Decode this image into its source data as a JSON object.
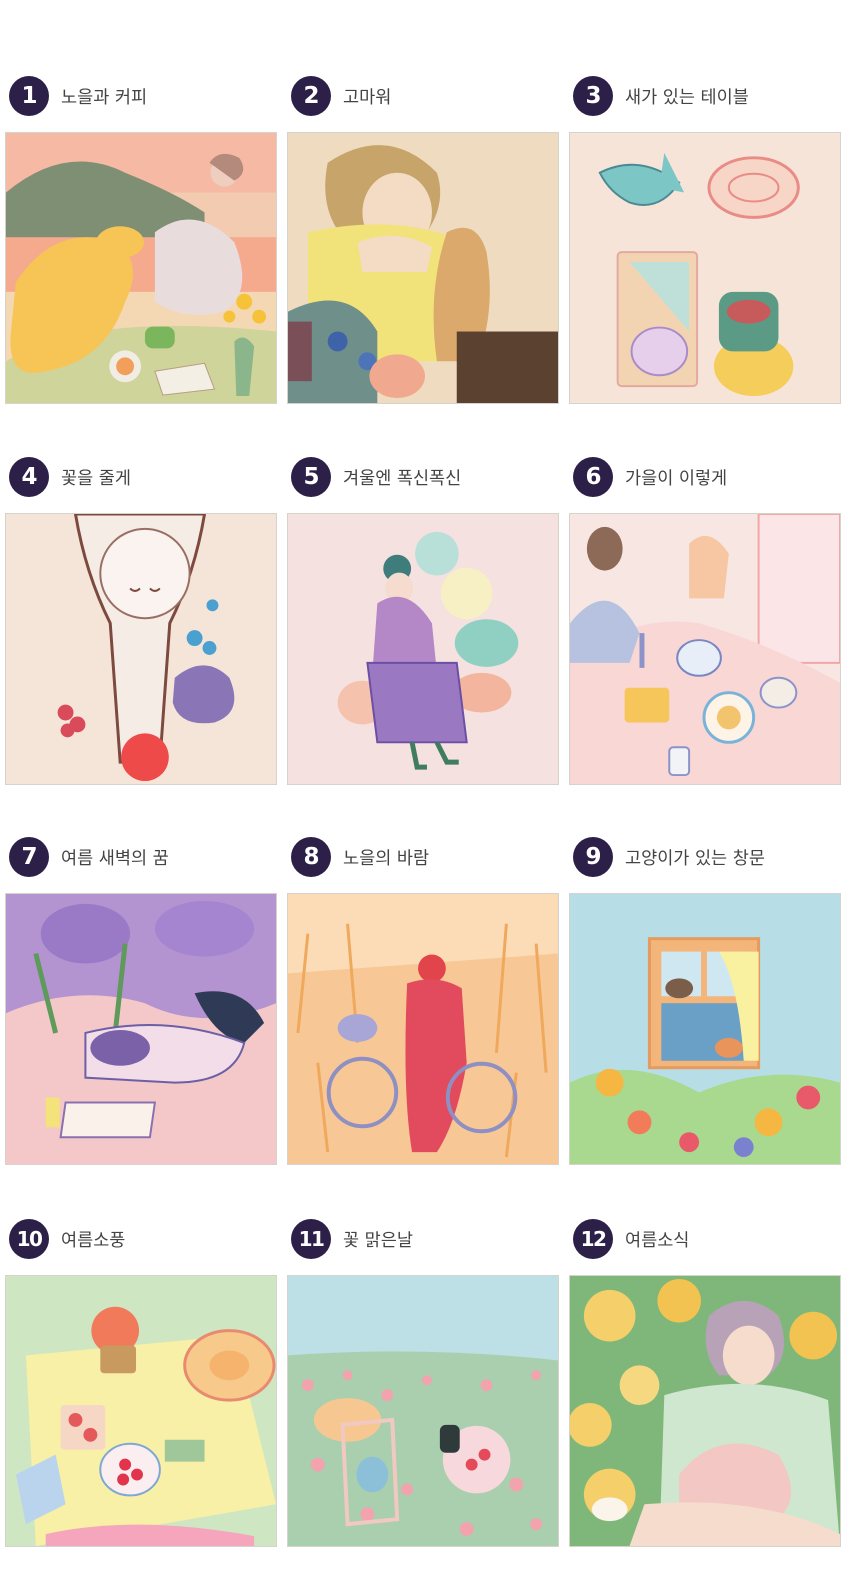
{
  "products": [
    {
      "number": "1",
      "title": "노을과 커피"
    },
    {
      "number": "2",
      "title": "고마워"
    },
    {
      "number": "3",
      "title": "새가 있는 테이블"
    },
    {
      "number": "4",
      "title": "꽃을 줄게"
    },
    {
      "number": "5",
      "title": "겨울엔 폭신폭신"
    },
    {
      "number": "6",
      "title": "가을이 이렇게"
    },
    {
      "number": "7",
      "title": "여름 새벽의 꿈"
    },
    {
      "number": "8",
      "title": "노을의 바람"
    },
    {
      "number": "9",
      "title": "고양이가 있는 창문"
    },
    {
      "number": "10",
      "title": "여름소풍"
    },
    {
      "number": "11",
      "title": "꽃 맑은날"
    },
    {
      "number": "12",
      "title": "여름소식"
    }
  ],
  "colors": {
    "badge_bg": "#2c2048",
    "badge_text": "#ffffff",
    "title_text": "#444444"
  }
}
